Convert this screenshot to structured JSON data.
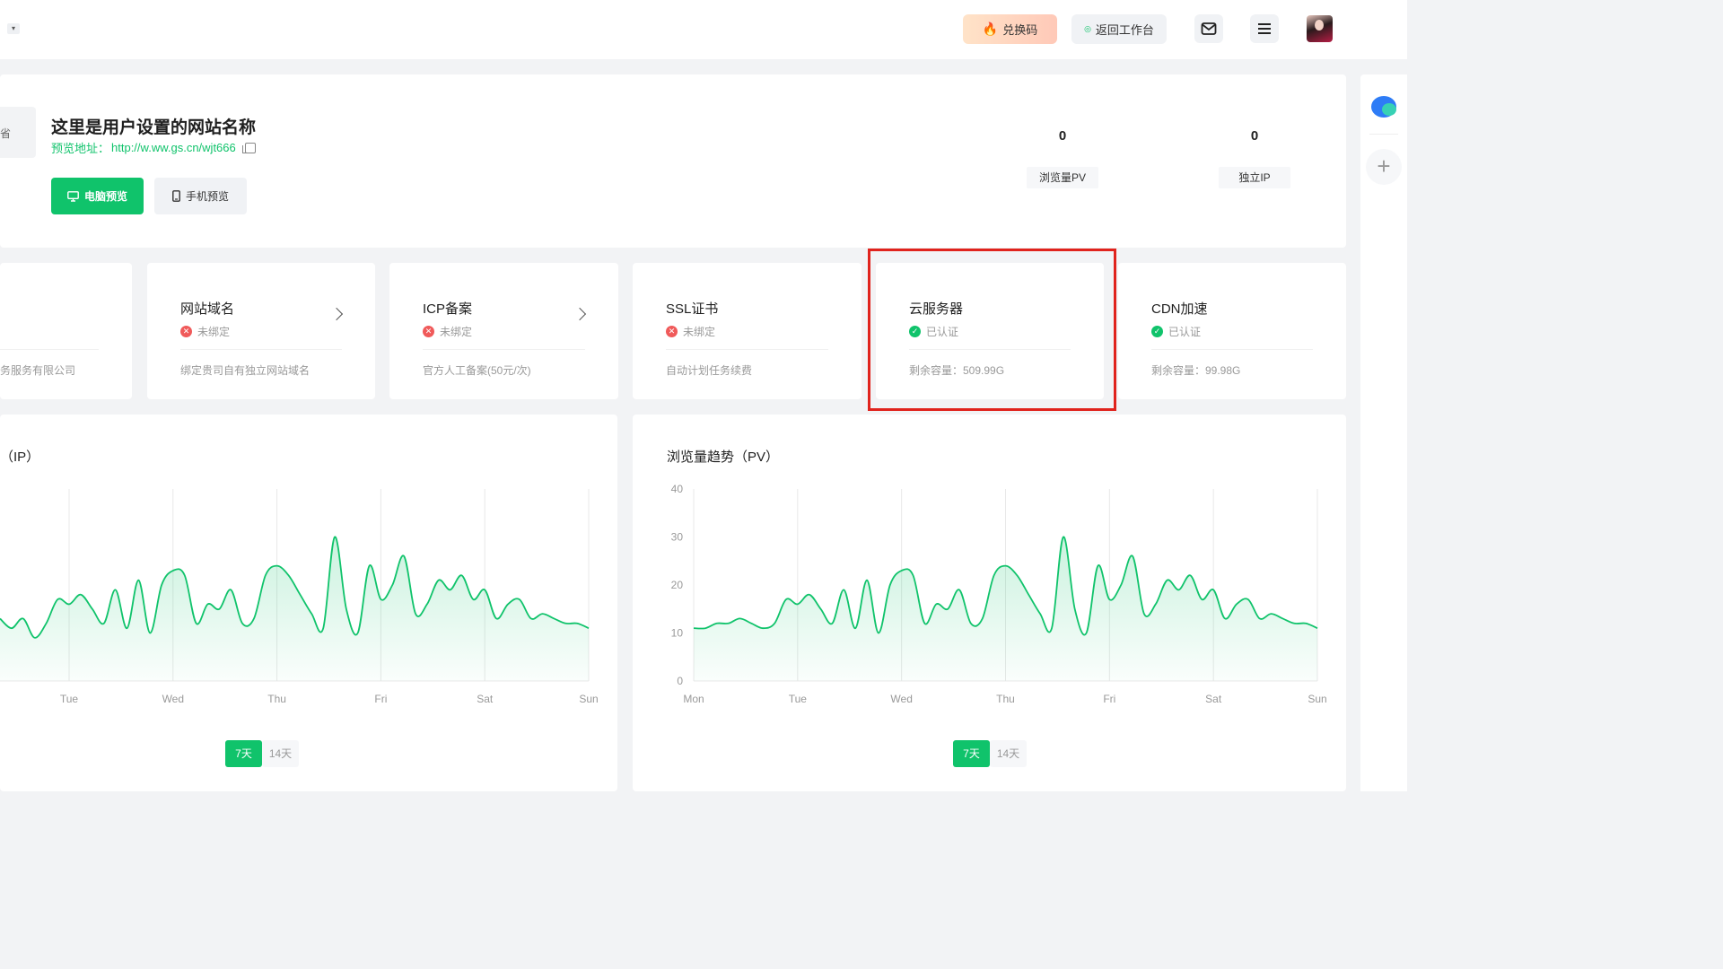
{
  "topbar": {
    "collapse_glyph": "▾",
    "redeem_label": "兑换码",
    "workbench_label": "返回工作台"
  },
  "site": {
    "thumb_text": "省",
    "name": "这里是用户设置的网站名称",
    "preview_label": "预览地址：",
    "preview_url": "http://w.ww.gs.cn/wjt666",
    "pc_preview_label": "电脑预览",
    "mobile_preview_label": "手机预览",
    "stats": [
      {
        "value": "0",
        "label": "浏览量PV"
      },
      {
        "value": "0",
        "label": "独立IP"
      }
    ]
  },
  "services": [
    {
      "title": "",
      "status": "",
      "desc": "务服务有限公司"
    },
    {
      "title": "网站域名",
      "status": "未绑定",
      "status_ok": false,
      "desc": "绑定贵司自有独立网站域名"
    },
    {
      "title": "ICP备案",
      "status": "未绑定",
      "status_ok": false,
      "desc": "官方人工备案(50元/次)"
    },
    {
      "title": "SSL证书",
      "status": "未绑定",
      "status_ok": false,
      "desc": "自动计划任务续费"
    },
    {
      "title": "云服务器",
      "status": "已认证",
      "status_ok": true,
      "desc": "剩余容量：509.99G"
    },
    {
      "title": "CDN加速",
      "status": "已认证",
      "status_ok": true,
      "desc": "剩余容量：99.98G"
    }
  ],
  "charts": {
    "left_title": "（IP）",
    "right_title": "浏览量趋势（PV）",
    "range_7": "7天",
    "range_14": "14天"
  },
  "chart_data": [
    {
      "type": "area",
      "title": "（IP）",
      "x_ticks": [
        "Tue",
        "Wed",
        "Thu",
        "Fri",
        "Sat",
        "Sun"
      ],
      "ylim": [
        0,
        40
      ],
      "series": [
        {
          "values": [
            13,
            11,
            13,
            9,
            12,
            17,
            16,
            18,
            15,
            12,
            19,
            11,
            21,
            10,
            20,
            23,
            22,
            12,
            16,
            15,
            19,
            12,
            13,
            22,
            24,
            22,
            18,
            14,
            11,
            30,
            15,
            10,
            24,
            17,
            20,
            26,
            14,
            16,
            21,
            19,
            22,
            17,
            19,
            13,
            16,
            17,
            13,
            14,
            13,
            12,
            12,
            11
          ]
        }
      ],
      "color": "#10c36b",
      "grid": "vertical"
    },
    {
      "type": "area",
      "title": "浏览量趋势（PV）",
      "x_ticks": [
        "Mon",
        "Tue",
        "Wed",
        "Thu",
        "Fri",
        "Sat",
        "Sun"
      ],
      "y_ticks": [
        "40",
        "30",
        "20",
        "10",
        "0"
      ],
      "ylim": [
        0,
        40
      ],
      "series": [
        {
          "values": [
            11,
            11,
            12,
            12,
            13,
            12,
            11,
            12,
            17,
            16,
            18,
            15,
            12,
            19,
            11,
            21,
            10,
            20,
            23,
            22,
            12,
            16,
            15,
            19,
            12,
            13,
            22,
            24,
            22,
            18,
            14,
            11,
            30,
            15,
            10,
            24,
            17,
            20,
            26,
            14,
            16,
            21,
            19,
            22,
            17,
            19,
            13,
            16,
            17,
            13,
            14,
            13,
            12,
            12,
            11
          ]
        }
      ],
      "color": "#10c36b",
      "grid": "vertical"
    }
  ]
}
